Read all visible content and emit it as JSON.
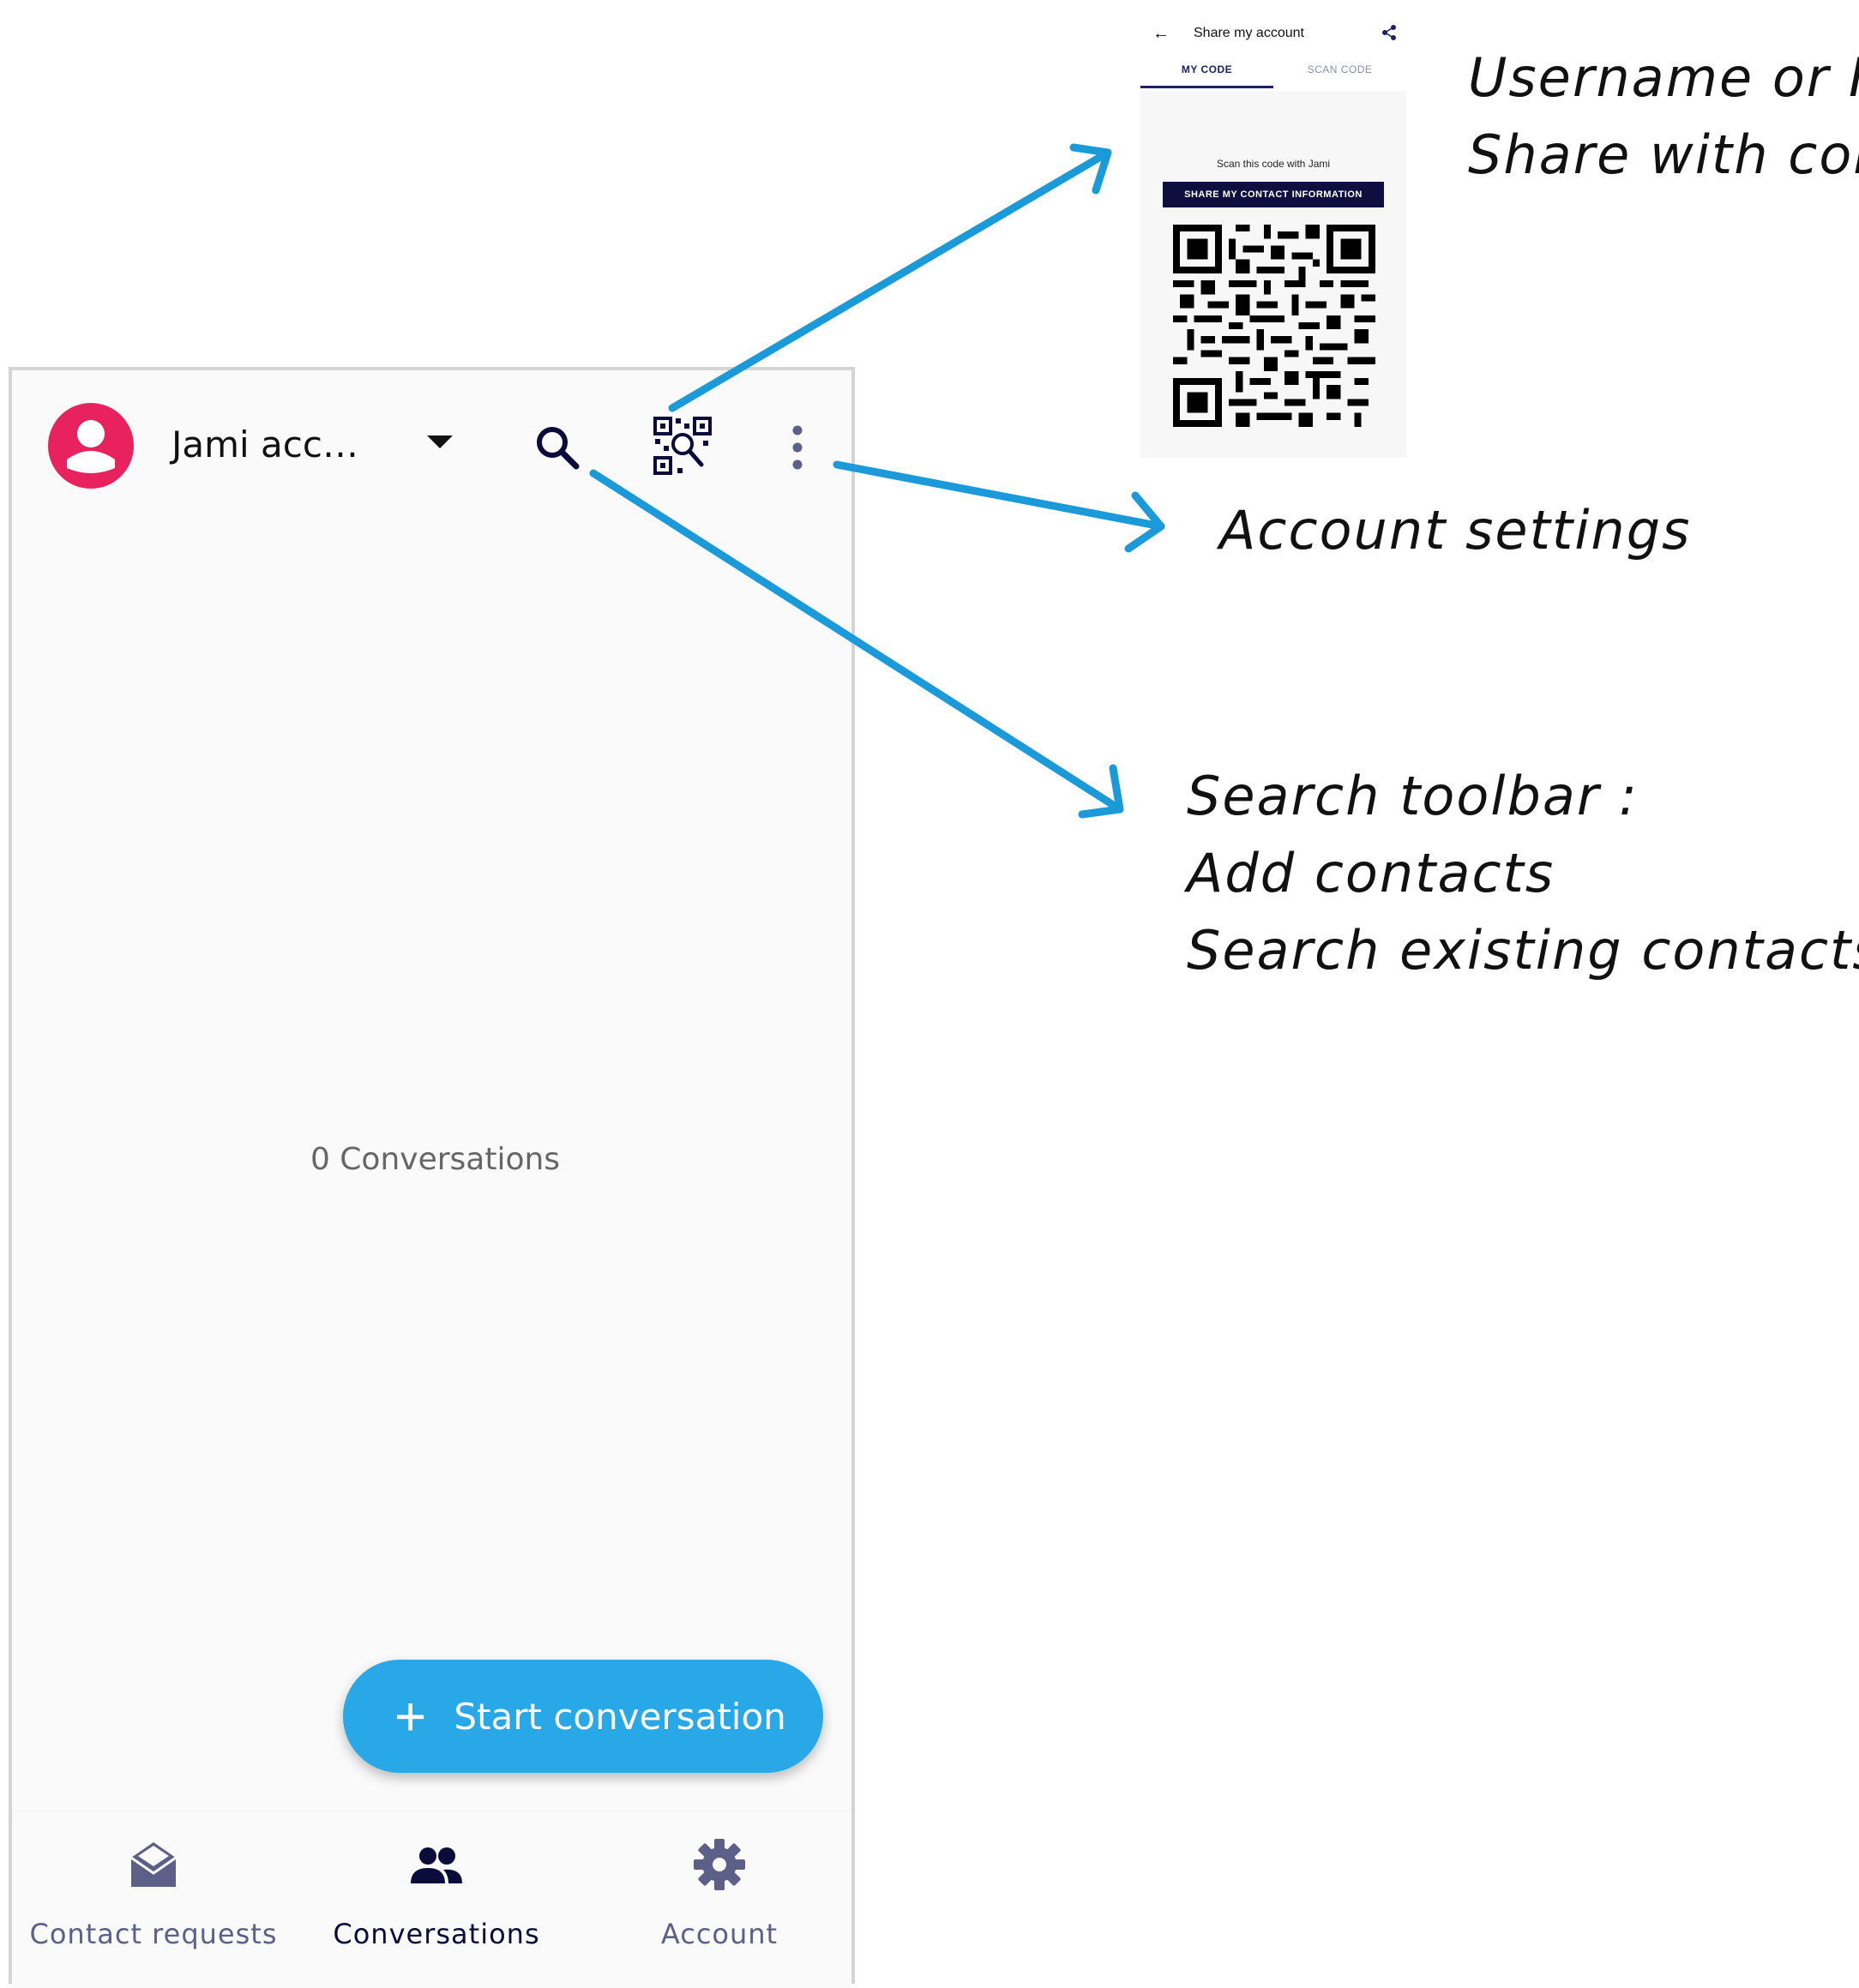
{
  "toolbar": {
    "account_name": "Jami acc…",
    "avatar_color": "#e8225e",
    "icons": [
      "account-avatar-icon",
      "dropdown-arrow-icon",
      "search-icon",
      "qr-code-icon",
      "more-vert-icon"
    ]
  },
  "main": {
    "empty_text": "0 Conversations"
  },
  "fab": {
    "icon": "plus-icon",
    "label": "Start conversation",
    "color": "#29a8e7"
  },
  "bottom_nav": {
    "items": [
      {
        "label": "Contact requests",
        "icon": "open-envelope-icon",
        "active": false
      },
      {
        "label": "Conversations",
        "icon": "people-icon",
        "active": true
      },
      {
        "label": "Account",
        "icon": "gear-icon",
        "active": false
      }
    ]
  },
  "share_screen": {
    "title": "Share my account",
    "tabs": [
      "MY CODE",
      "SCAN CODE"
    ],
    "caption": "Scan this code with Jami",
    "button_label": "SHARE MY CONTACT INFORMATION"
  },
  "annotations": {
    "qr_lines": [
      "Username or I",
      "Share with cor"
    ],
    "settings": "Account settings",
    "search_lines": [
      "Search toolbar :",
      "Add contacts",
      "Search existing contacts"
    ],
    "arrow_color": "#1a9ad8"
  }
}
